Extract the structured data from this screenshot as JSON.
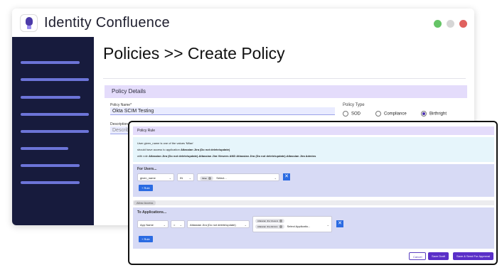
{
  "app": {
    "title": "Identity Confluence"
  },
  "page": {
    "title": "Policies >> Create Policy"
  },
  "policy_details": {
    "heading": "Policy Details",
    "name_label": "Policy Name*",
    "name_value": "Okta SCIM Testing",
    "description_label": "Description",
    "description_placeholder": "Describ",
    "type_label": "Policy Type",
    "types": [
      "SOD",
      "Compliance",
      "Birthright"
    ],
    "selected_type": "Birthright"
  },
  "rule": {
    "heading": "Policy Rule",
    "summary_line1": "User given_name is one of the values 'Milan'",
    "summary_line2_prefix": "should have access to application ",
    "summary_line2_app": "Atlassian Jira (Do not delete/update)",
    "summary_line3_prefix": "with role ",
    "summary_line3_roles": "Atlassian Jira (Do not delete/update).Atlassian Jira Viewers AND Atlassian Jira (Do not delete/update).Atlassian Jira Admins",
    "users": {
      "title": "For Users...",
      "attribute": "given_name",
      "operator": "IN",
      "value_chip": "Milan",
      "select_placeholder": "Select...",
      "add_rule": "+ Rule"
    },
    "allow_label": "Allow Access",
    "apps": {
      "title": "To Applications...",
      "attribute": "App Name",
      "operator": "=",
      "app_value": "Atlassian Jira (Do not delete/update)",
      "role_chips": [
        "Atlassian Jira Viewers",
        "Atlassian Jira Admins"
      ],
      "select_placeholder": "Select Applicatio...",
      "add_rule": "+ Rule"
    },
    "buttons": {
      "cancel": "Cancel",
      "draft": "Save Draft",
      "send": "Save & Send For Approval"
    }
  },
  "colors": {
    "sidebar": "#171b3d",
    "accent": "#5a2fc8",
    "section": "#e4dcfb",
    "blue_button": "#2b6be2"
  }
}
